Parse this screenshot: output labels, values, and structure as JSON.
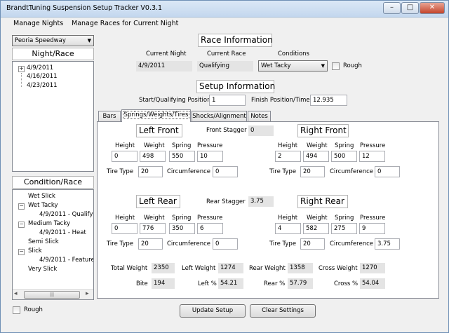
{
  "window": {
    "title": "BrandtTuning Suspension Setup Tracker V0.3.1",
    "minimize": "–",
    "maximize": "□",
    "close": "✕"
  },
  "menu": [
    "Manage Nights",
    "Manage Races for Current Night"
  ],
  "sidebar": {
    "track": "Peoria Speedway",
    "night_header": "Night/Race",
    "nights": [
      "4/9/2011",
      "4/16/2011",
      "4/23/2011"
    ],
    "condition_header": "Condition/Race",
    "conditions": [
      {
        "label": "Wet Slick",
        "indent": 0,
        "expander": ""
      },
      {
        "label": "Wet Tacky",
        "indent": 0,
        "expander": "−"
      },
      {
        "label": "4/9/2011 - Qualifying",
        "indent": 1,
        "expander": ""
      },
      {
        "label": "Medium Tacky",
        "indent": 0,
        "expander": "−"
      },
      {
        "label": "4/9/2011 - Heat",
        "indent": 1,
        "expander": ""
      },
      {
        "label": "Semi Slick",
        "indent": 0,
        "expander": ""
      },
      {
        "label": "Slick",
        "indent": 0,
        "expander": "−"
      },
      {
        "label": "4/9/2011 - Feature",
        "indent": 1,
        "expander": ""
      },
      {
        "label": "Very Slick",
        "indent": 0,
        "expander": ""
      }
    ],
    "rough_label": "Rough"
  },
  "race_info": {
    "header": "Race Information",
    "current_night_label": "Current Night",
    "current_race_label": "Current Race",
    "conditions_label": "Conditions",
    "current_night": "4/9/2011",
    "current_race": "Qualifying",
    "condition": "Wet Tacky",
    "rough_label": "Rough"
  },
  "setup_info": {
    "header": "Setup Information",
    "start_label": "Start/Qualifying Position",
    "start_value": "1",
    "finish_label": "Finish Position/Time",
    "finish_value": "12.935"
  },
  "tabs": [
    "Bars",
    "Springs/Weights/Tires",
    "Shocks/Alignment",
    "Notes"
  ],
  "corners": {
    "height_label": "Height",
    "weight_label": "Weight",
    "spring_label": "Spring",
    "pressure_label": "Pressure",
    "tire_type_label": "Tire Type",
    "circumference_label": "Circumference",
    "lf": {
      "title": "Left Front",
      "height": "0",
      "weight": "498",
      "spring": "550",
      "pressure": "10",
      "tire": "20",
      "circ": "0"
    },
    "rf": {
      "title": "Right Front",
      "height": "2",
      "weight": "494",
      "spring": "500",
      "pressure": "12",
      "tire": "20",
      "circ": "0"
    },
    "lr": {
      "title": "Left Rear",
      "height": "0",
      "weight": "776",
      "spring": "350",
      "pressure": "6",
      "tire": "20",
      "circ": "0"
    },
    "rr": {
      "title": "Right Rear",
      "height": "4",
      "weight": "582",
      "spring": "275",
      "pressure": "9",
      "tire": "20",
      "circ": "3.75"
    }
  },
  "stagger": {
    "front_label": "Front Stagger",
    "front_value": "0",
    "rear_label": "Rear Stagger",
    "rear_value": "3.75"
  },
  "totals": {
    "total_weight_label": "Total Weight",
    "total_weight": "2350",
    "left_weight_label": "Left Weight",
    "left_weight": "1274",
    "rear_weight_label": "Rear Weight",
    "rear_weight": "1358",
    "cross_weight_label": "Cross Weight",
    "cross_weight": "1270",
    "bite_label": "Bite",
    "bite": "194",
    "left_pct_label": "Left %",
    "left_pct": "54.21",
    "rear_pct_label": "Rear %",
    "rear_pct": "57.79",
    "cross_pct_label": "Cross %",
    "cross_pct": "54.04"
  },
  "buttons": {
    "update": "Update Setup",
    "clear": "Clear Settings"
  },
  "scrollbar": {
    "left": "◂",
    "right": "▸",
    "grip": "|||"
  }
}
